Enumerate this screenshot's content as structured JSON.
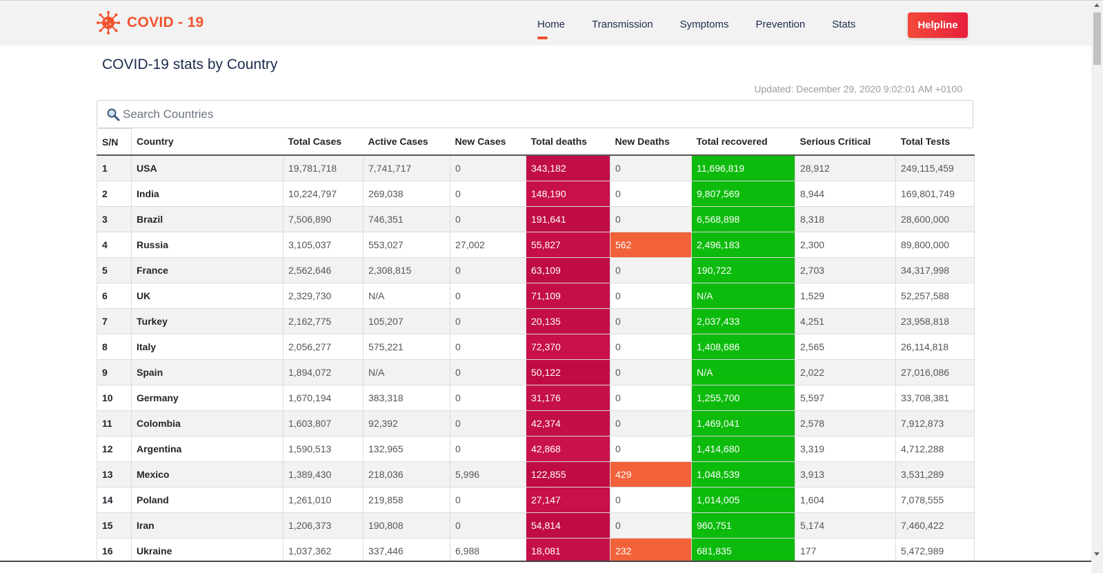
{
  "brand": {
    "name": "COVID - 19",
    "accent": "#f3522e"
  },
  "nav": {
    "links": [
      {
        "label": "Home",
        "active": true
      },
      {
        "label": "Transmission",
        "active": false
      },
      {
        "label": "Symptoms",
        "active": false
      },
      {
        "label": "Prevention",
        "active": false
      },
      {
        "label": "Stats",
        "active": false
      }
    ],
    "helpline": "Helpline"
  },
  "main": {
    "title": "COVID-19 stats by Country",
    "updated": "Updated: December 29, 2020 9:02:01 AM +0100",
    "search": {
      "placeholder": "Search Countries",
      "value": "",
      "icon": "search-icon"
    }
  },
  "colors": {
    "deaths": "#c20e46",
    "recovered": "#0dbb0d",
    "new_deaths_highlight": "#f2623a",
    "helpline": "#e81e3b"
  },
  "table": {
    "headers": [
      "S/N",
      "Country",
      "Total Cases",
      "Active Cases",
      "New Cases",
      "Total deaths",
      "New Deaths",
      "Total recovered",
      "Serious Critical",
      "Total Tests"
    ],
    "rows": [
      [
        "1",
        "USA",
        "19,781,718",
        "7,741,717",
        "0",
        "343,182",
        "0",
        "11,696,819",
        "28,912",
        "249,115,459"
      ],
      [
        "2",
        "India",
        "10,224,797",
        "269,038",
        "0",
        "148,190",
        "0",
        "9,807,569",
        "8,944",
        "169,801,749"
      ],
      [
        "3",
        "Brazil",
        "7,506,890",
        "746,351",
        "0",
        "191,641",
        "0",
        "6,568,898",
        "8,318",
        "28,600,000"
      ],
      [
        "4",
        "Russia",
        "3,105,037",
        "553,027",
        "27,002",
        "55,827",
        "562",
        "2,496,183",
        "2,300",
        "89,800,000"
      ],
      [
        "5",
        "France",
        "2,562,646",
        "2,308,815",
        "0",
        "63,109",
        "0",
        "190,722",
        "2,703",
        "34,317,998"
      ],
      [
        "6",
        "UK",
        "2,329,730",
        "N/A",
        "0",
        "71,109",
        "0",
        "N/A",
        "1,529",
        "52,257,588"
      ],
      [
        "7",
        "Turkey",
        "2,162,775",
        "105,207",
        "0",
        "20,135",
        "0",
        "2,037,433",
        "4,251",
        "23,958,818"
      ],
      [
        "8",
        "Italy",
        "2,056,277",
        "575,221",
        "0",
        "72,370",
        "0",
        "1,408,686",
        "2,565",
        "26,114,818"
      ],
      [
        "9",
        "Spain",
        "1,894,072",
        "N/A",
        "0",
        "50,122",
        "0",
        "N/A",
        "2,022",
        "27,016,086"
      ],
      [
        "10",
        "Germany",
        "1,670,194",
        "383,318",
        "0",
        "31,176",
        "0",
        "1,255,700",
        "5,597",
        "33,708,381"
      ],
      [
        "11",
        "Colombia",
        "1,603,807",
        "92,392",
        "0",
        "42,374",
        "0",
        "1,469,041",
        "2,578",
        "7,912,873"
      ],
      [
        "12",
        "Argentina",
        "1,590,513",
        "132,965",
        "0",
        "42,868",
        "0",
        "1,414,680",
        "3,319",
        "4,712,288"
      ],
      [
        "13",
        "Mexico",
        "1,389,430",
        "218,036",
        "5,996",
        "122,855",
        "429",
        "1,048,539",
        "3,913",
        "3,531,289"
      ],
      [
        "14",
        "Poland",
        "1,261,010",
        "219,858",
        "0",
        "27,147",
        "0",
        "1,014,005",
        "1,604",
        "7,078,555"
      ],
      [
        "15",
        "Iran",
        "1,206,373",
        "190,808",
        "0",
        "54,814",
        "0",
        "960,751",
        "5,174",
        "7,460,422"
      ],
      [
        "16",
        "Ukraine",
        "1,037,362",
        "337,446",
        "6,988",
        "18,081",
        "232",
        "681,835",
        "177",
        "5,472,989"
      ]
    ]
  }
}
